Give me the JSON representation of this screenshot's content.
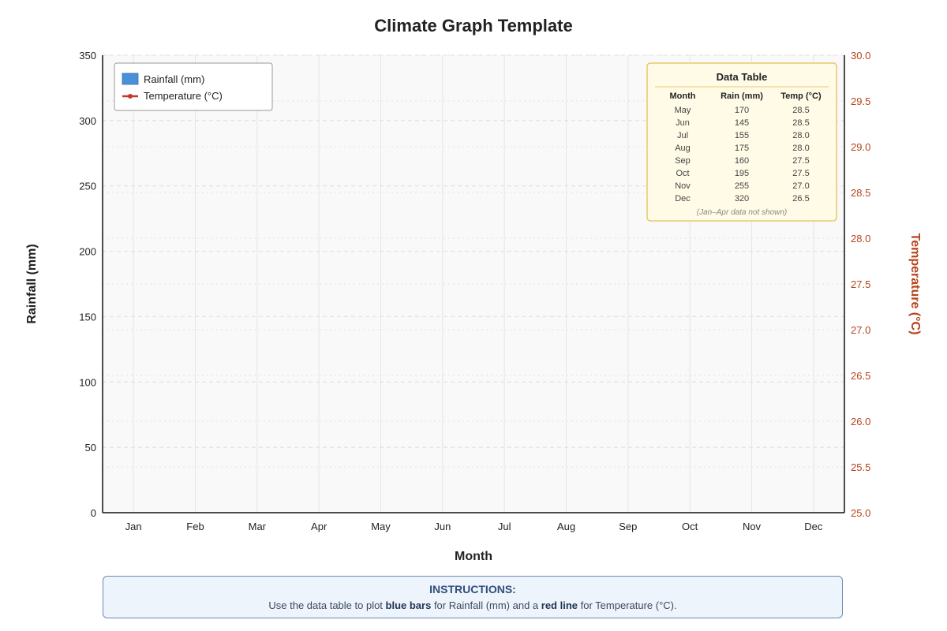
{
  "chart_data": {
    "type": "bar",
    "title": "Climate Graph Template",
    "xlabel": "Month",
    "ylabel": "Rainfall (mm)",
    "y2label": "Temperature (°C)",
    "categories": [
      "Jan",
      "Feb",
      "Mar",
      "Apr",
      "May",
      "Jun",
      "Jul",
      "Aug",
      "Sep",
      "Oct",
      "Nov",
      "Dec"
    ],
    "ylim": [
      0,
      350
    ],
    "y2lim": [
      25.0,
      30.0
    ],
    "yticks": [
      "0",
      "50",
      "100",
      "150",
      "200",
      "250",
      "300",
      "350"
    ],
    "y2ticks": [
      "25.0",
      "25.5",
      "26.0",
      "26.5",
      "27.0",
      "27.5",
      "28.0",
      "28.5",
      "29.0",
      "29.5",
      "30.0"
    ],
    "grid": true,
    "legend_position": "top-left",
    "series": [
      {
        "name": "Rainfall (mm)",
        "kind": "bar",
        "color": "#4a90d9",
        "plotted": false
      },
      {
        "name": "Temperature (°C)",
        "kind": "line",
        "color": "#c0392b",
        "plotted": false
      }
    ],
    "table": {
      "title": "Data Table",
      "headers": [
        "Month",
        "Rain (mm)",
        "Temp (°C)"
      ],
      "rows": [
        [
          "May",
          "170",
          "28.5"
        ],
        [
          "Jun",
          "145",
          "28.5"
        ],
        [
          "Jul",
          "155",
          "28.0"
        ],
        [
          "Aug",
          "175",
          "28.0"
        ],
        [
          "Sep",
          "160",
          "27.5"
        ],
        [
          "Oct",
          "195",
          "27.5"
        ],
        [
          "Nov",
          "255",
          "27.0"
        ],
        [
          "Dec",
          "320",
          "26.5"
        ]
      ],
      "note": "(Jan–Apr data not shown)"
    }
  },
  "instructions": {
    "title": "INSTRUCTIONS:",
    "part1": "Use the data table to plot ",
    "bold1": "blue bars",
    "part2": " for Rainfall (mm) and a ",
    "bold2": "red line",
    "part3": " for Temperature (°C)."
  },
  "colors": {
    "rain": "#4a90d9",
    "temp": "#c0392b",
    "temp_axis": "#b5441b",
    "table_bg": "#fffbe6",
    "table_border": "#e8c96a"
  }
}
